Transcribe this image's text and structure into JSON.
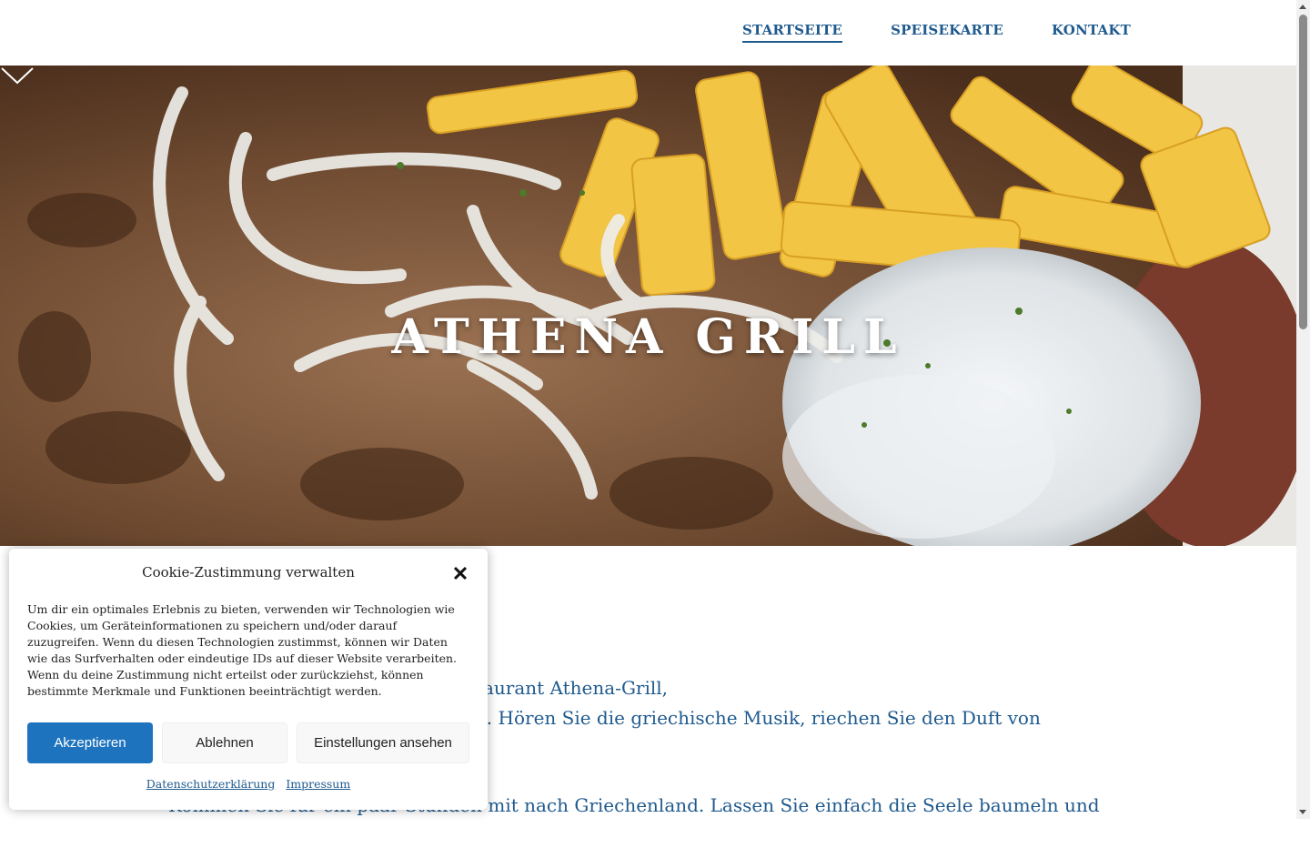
{
  "nav": {
    "items": [
      {
        "label": "STARTSEITE",
        "active": true
      },
      {
        "label": "SPEISEKARTE",
        "active": false
      },
      {
        "label": "KONTAKT",
        "active": false
      }
    ]
  },
  "hero": {
    "title": "ATHENA GRILL",
    "scroll_icon": "chevron-down-icon"
  },
  "content": {
    "line1": "Willkommen im griechischen Restaurant Athena-Grill,",
    "line2": "treten Sie ein und genießen Sie es. Hören Sie die griechische Musik, riechen Sie den Duft von frischen",
    "line3": "Kommen Sie für ein paar Stunden mit nach Griechenland. Lassen Sie einfach die Seele baumeln und"
  },
  "cookie": {
    "title": "Cookie-Zustimmung verwalten",
    "close_icon": "close-icon",
    "text": "Um dir ein optimales Erlebnis zu bieten, verwenden wir Technologien wie Cookies, um Geräteinformationen zu speichern und/oder darauf zuzugreifen. Wenn du diesen Technologien zustimmst, können wir Daten wie das Surfverhalten oder eindeutige IDs auf dieser Website verarbeiten. Wenn du deine Zustimmung nicht erteilst oder zurückziehst, können bestimmte Merkmale und Funktionen beeinträchtigt werden.",
    "accept_label": "Akzeptieren",
    "deny_label": "Ablehnen",
    "settings_label": "Einstellungen ansehen",
    "privacy_link": "Datenschutzerklärung",
    "imprint_link": "Impressum"
  },
  "colors": {
    "accent": "#1f5a8e",
    "button_primary": "#1e73be"
  }
}
